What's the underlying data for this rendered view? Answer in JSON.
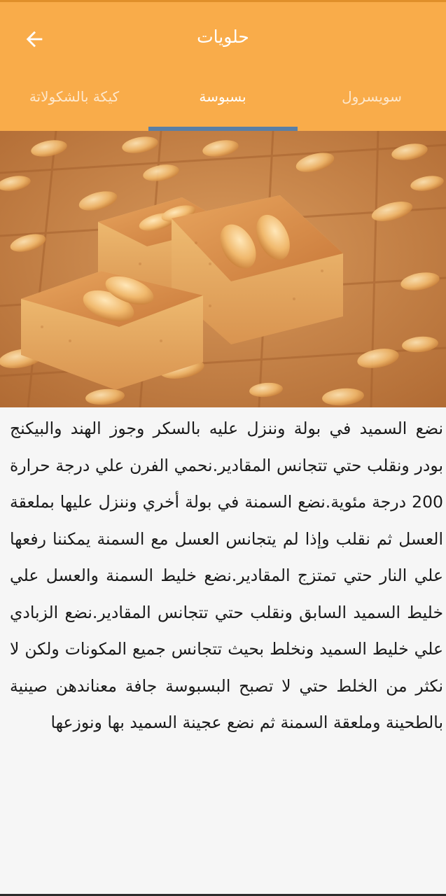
{
  "header": {
    "title": "حلويات",
    "back_icon": "arrow-left-icon"
  },
  "tabs": [
    {
      "label": "سويسرول",
      "active": false
    },
    {
      "label": "بسبوسة",
      "active": true
    },
    {
      "label": "كيكة بالشكولاتة",
      "active": false
    }
  ],
  "hero_image": {
    "icon": "basbousa-photo"
  },
  "recipe": {
    "text": "نضع السميد في بولة وننزل عليه بالسكر وجوز الهند والبيكنج بودر ونقلب حتي تتجانس المقادير.نحمي الفرن علي درجة حرارة 200 درجة مئوية.نضع السمنة في بولة أخري وننزل عليها بملعقة العسل ثم نقلب وإذا لم يتجانس العسل مع السمنة يمكننا رفعها علي النار حتي تمتزج المقادير.نضع خليط السمنة والعسل علي خليط السميد السابق ونقلب حتي تتجانس المقادير.نضع الزبادي علي خليط السميد ونخلط بحيث تتجانس جميع المكونات ولكن لا نكثر من الخلط حتي لا تصبح البسبوسة جافة معناندهن صينية بالطحينة وملعقة السمنة ثم نضع عجينة السميد بها ونوزعها"
  },
  "colors": {
    "appbar": "#f9ac4a",
    "indicator": "#5a7fa6",
    "background": "#f6f6f6"
  }
}
